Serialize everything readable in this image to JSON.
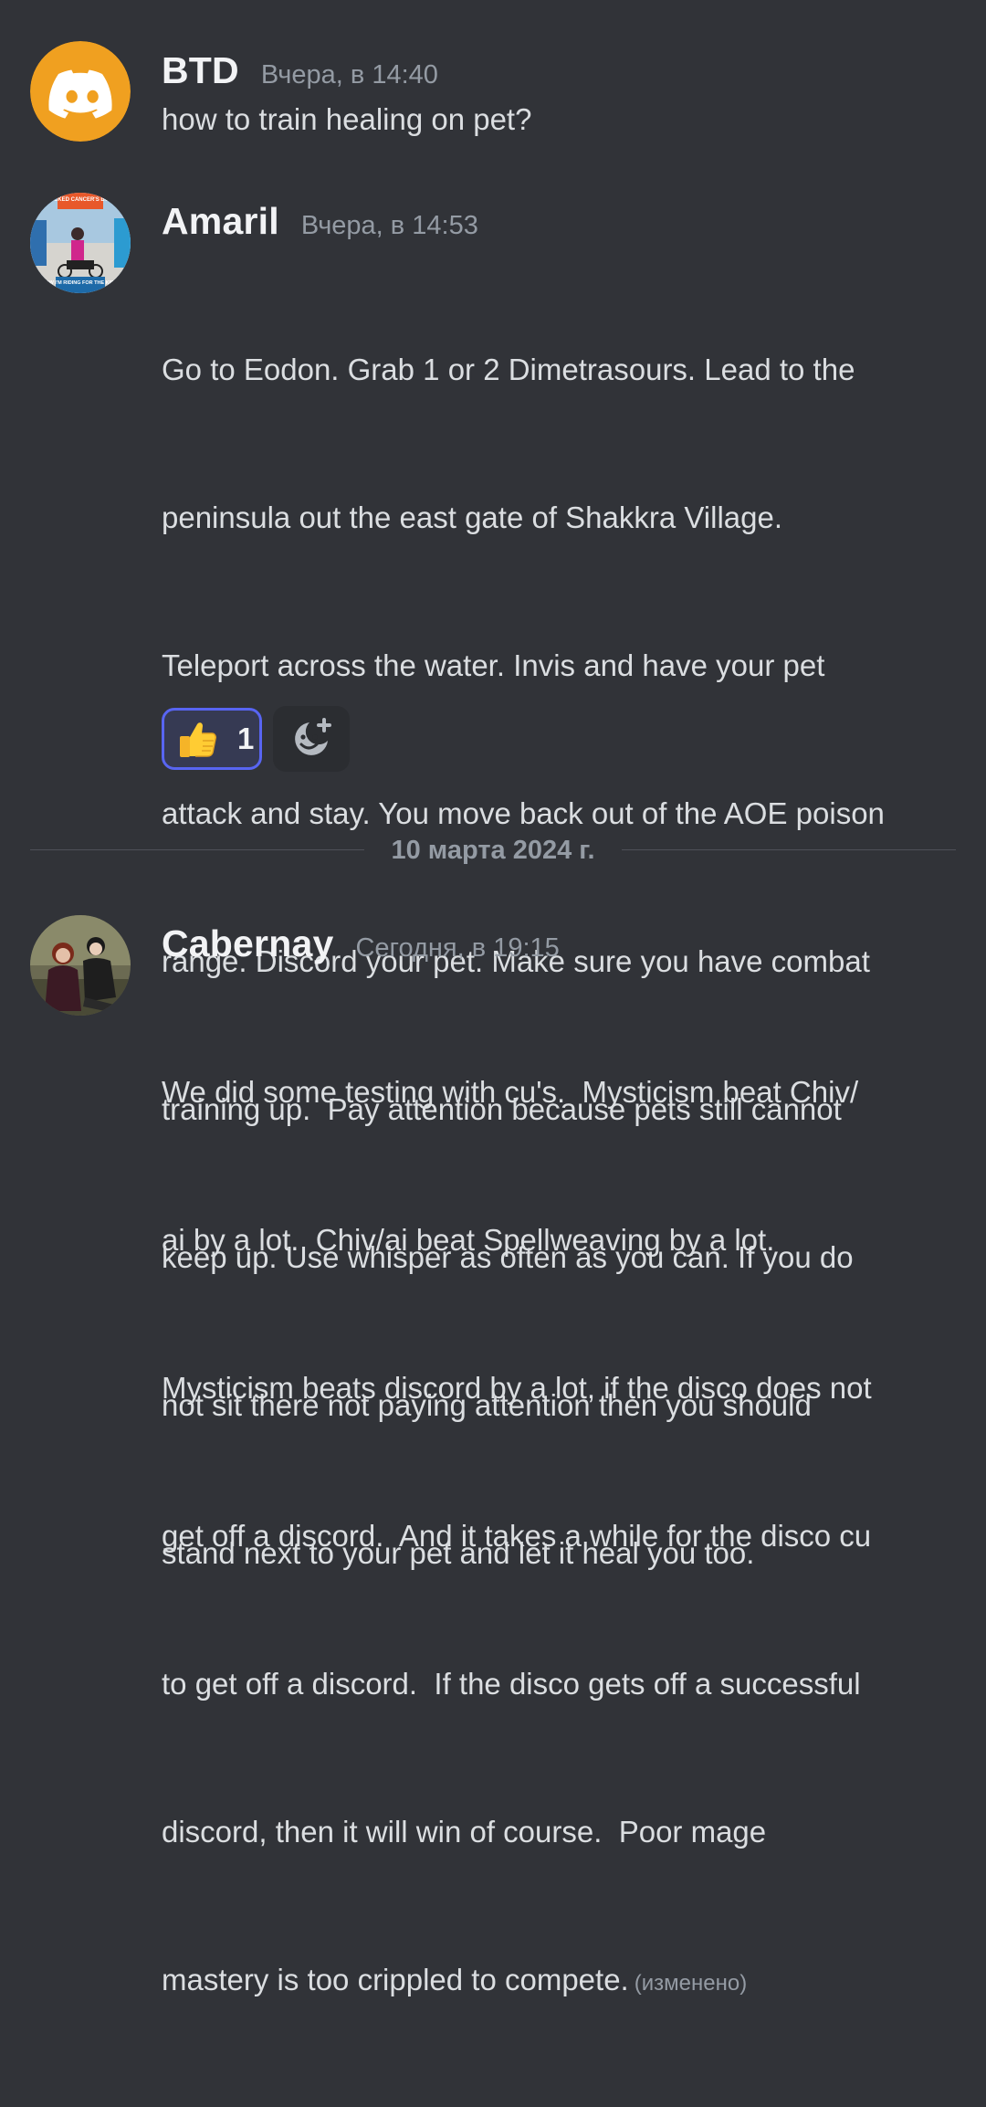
{
  "messages": [
    {
      "author": "BTD",
      "timestamp": "Вчера, в 14:40",
      "content": "how to train healing on pet?",
      "avatar": {
        "type": "discord-default",
        "color": "#f0a020"
      }
    },
    {
      "author": "Amaril",
      "timestamp": "Вчера, в 14:53",
      "content_lines": [
        "Go to Eodon. Grab 1 or 2 Dimetrasours. Lead to the",
        "peninsula out the east gate of Shakkra Village.",
        "Teleport across the water. Invis and have your pet",
        "attack and stay. You move back out of the AOE poison",
        "range. Discord your pet. Make sure you have combat",
        "training up.  Pay attention because pets still cannot",
        "keep up. Use whisper as often as you can. If you do",
        "not sit there not paying attention then you should",
        "stand next to your pet and let it heal you too."
      ],
      "avatar": {
        "type": "photo",
        "banner_top": "I KICKED CANCER'S BUTT",
        "banner_bottom": "NOW I'M RIDING FOR THE KIDS!"
      },
      "reactions": [
        {
          "emoji": "thumbs-up-icon",
          "count": "1"
        }
      ],
      "add_reaction_icon": "add-reaction-icon"
    },
    {
      "author": "Cabernay",
      "timestamp": "Сегодня, в 19:15",
      "content_lines": [
        "We did some testing with cu's.  Mysticism beat Chiv/",
        "ai by a lot.  Chiv/ai beat Spellweaving by a lot.",
        "Mysticism beats discord by a lot, if the disco does not",
        "get off a discord.  And it takes a while for the disco cu",
        "to get off a discord.  If the disco gets off a successful",
        "discord, then it will win of course.  Poor mage",
        "mastery is too crippled to compete."
      ],
      "edited": "(изменено)",
      "avatar": {
        "type": "photo"
      }
    }
  ],
  "date_divider": "10 марта 2024 г.",
  "colors": {
    "background": "#313338",
    "author": "#f2f3f5",
    "timestamp": "#949ba4",
    "text": "#dbdee1",
    "reaction_border": "#5865f2"
  }
}
